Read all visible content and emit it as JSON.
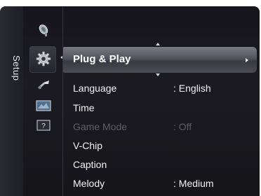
{
  "sidebar": {
    "tab_label": "Setup",
    "categories": [
      {
        "icon": "satellite-dish-icon"
      },
      {
        "icon": "gear-icon"
      },
      {
        "icon": "satellite-icon"
      },
      {
        "icon": "input-icon"
      },
      {
        "icon": "help-icon",
        "glyph": "?"
      }
    ]
  },
  "menu": {
    "highlighted": {
      "label": "Plug & Play"
    },
    "items": [
      {
        "label": "Language",
        "value": ": English",
        "enabled": true
      },
      {
        "label": "Time",
        "value": "",
        "enabled": true
      },
      {
        "label": "Game Mode",
        "value": ": Off",
        "enabled": false
      },
      {
        "label": "V-Chip",
        "value": "",
        "enabled": true
      },
      {
        "label": "Caption",
        "value": "",
        "enabled": true
      },
      {
        "label": "Melody",
        "value": ": Medium",
        "enabled": true
      }
    ]
  },
  "colors": {
    "panel_bg": "#18181e",
    "highlight": "#5c5c66",
    "text": "#f2f2f5",
    "disabled_text": "#5e5e66"
  }
}
